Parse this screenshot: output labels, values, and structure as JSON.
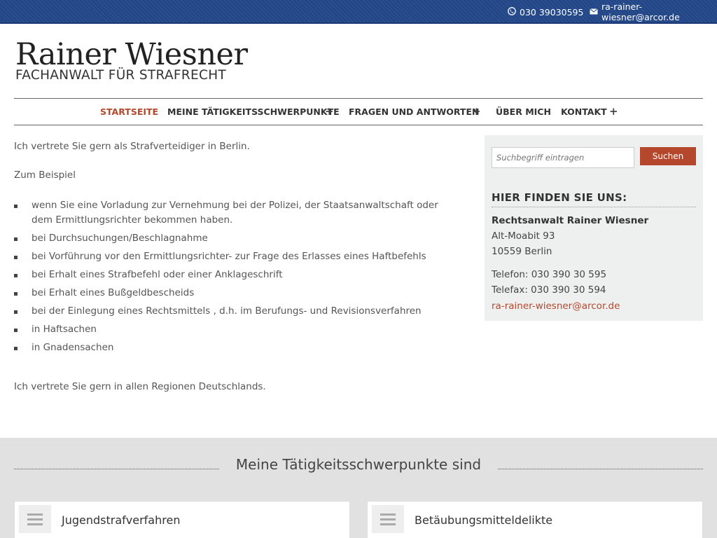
{
  "topbar": {
    "phone": "030 39030595",
    "email": "ra-rainer-wiesner@arcor.de",
    "phone_icon": "phone-icon",
    "email_icon": "envelope-icon"
  },
  "logo": {
    "name": "Rainer Wiesner",
    "subtitle": "FACHANWALT FÜR STRAFRECHT"
  },
  "nav": {
    "items": [
      {
        "label": "Startseite",
        "active": true
      },
      {
        "label": "Meine Tätigkeitsschwerpunkte",
        "has_submenu": true
      },
      {
        "label": "Fragen und Antworten",
        "has_submenu": true
      },
      {
        "label": "Über mich"
      },
      {
        "label": "Kontakt",
        "has_submenu": true
      }
    ],
    "submenu_glyph": "+"
  },
  "main": {
    "intro": "Ich vertrete Sie gern als Strafverteidiger in Berlin.",
    "example": "Zum Beispiel",
    "list": [
      "wenn Sie eine Vorladung zur Vernehmung bei der Polizei, der Staatsanwaltschaft oder dem Ermittlungsrichter bekommen haben.",
      "bei Durchsuchungen/Beschlagnahme",
      "bei Vorführung vor den Ermittlungsrichter- zur Frage des Erlasses eines Haftbefehls",
      "bei Erhalt eines Strafbefehl oder einer Anklageschrift",
      "bei Erhalt eines Bußgeldbescheids",
      "bei der Einlegung eines Rechtsmittels , d.h. im Berufungs- und Revisionsverfahren",
      "in Haftsachen",
      "in Gnadensachen"
    ],
    "closing": "Ich vertrete Sie gern in allen Regionen Deutschlands."
  },
  "sidebar": {
    "search_placeholder": "Suchbegriff eintragen",
    "search_button": "Suchen",
    "heading": "Hier finden Sie uns:",
    "firm": "Rechtsanwalt Rainer Wiesner",
    "street": "Alt-Moabit 93",
    "city": "10559 Berlin",
    "telefon": "Telefon: 030 390 30 595",
    "telefax": "Telefax: 030 390 30 594",
    "email": "ra-rainer-wiesner@arcor.de"
  },
  "bottom": {
    "title": "Meine Tätigkeitsschwerpunkte sind",
    "cards": [
      {
        "label": "Jugendstrafverfahren",
        "icon": "menu-icon"
      },
      {
        "label": "Betäubungsmitteldelikte",
        "icon": "menu-icon"
      }
    ]
  },
  "colors": {
    "topbar": "#23488a",
    "accent": "#b5482c",
    "sidebar_bg": "#eef0f0",
    "footer_bg": "#e1e1e1"
  }
}
